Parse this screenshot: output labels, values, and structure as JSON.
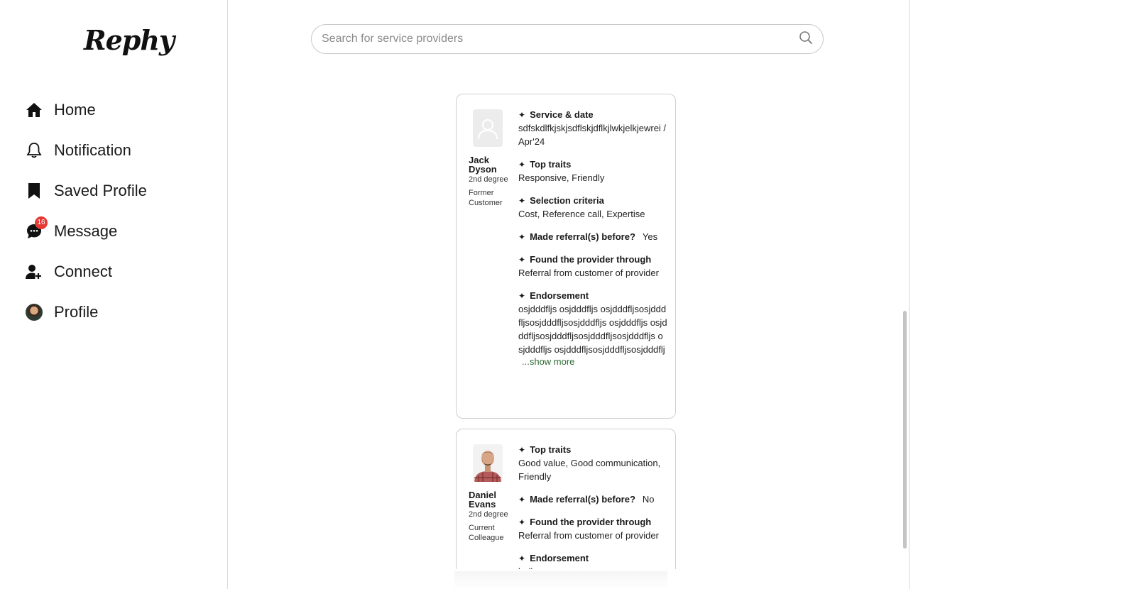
{
  "app": {
    "logo": "Rephy"
  },
  "sidebar": {
    "items": [
      {
        "label": "Home",
        "icon": "home-icon"
      },
      {
        "label": "Notification",
        "icon": "bell-icon"
      },
      {
        "label": "Saved Profile",
        "icon": "bookmark-icon"
      },
      {
        "label": "Message",
        "icon": "message-icon",
        "badge": "16"
      },
      {
        "label": "Connect",
        "icon": "add-user-icon"
      },
      {
        "label": "Profile",
        "icon": "avatar"
      }
    ]
  },
  "search": {
    "placeholder": "Search for service providers"
  },
  "cards": [
    {
      "name": "Jack Dyson",
      "degree": "2nd degree",
      "relation": "Former Customer",
      "service_title": "Service & date",
      "service_value": "sdfskdlfkjskjsdflskjdflkjlwkjelkjewrei / Apr'24",
      "traits_title": "Top traits",
      "traits_value": "Responsive, Friendly",
      "criteria_title": "Selection criteria",
      "criteria_value": "Cost, Reference call, Expertise",
      "referral_title": "Made referral(s) before?",
      "referral_value": "Yes",
      "found_title": "Found the provider through",
      "found_value": "Referral from customer of provider",
      "endorsement_title": "Endorsement",
      "endorsement_value": "osjdddfljs osjdddfljs osjdddfljsosjdddfljsosjdddfljsosjdddfljs osjdddfljs osjdddfljsosjdddfljsosjdddfljsosjdddfljs osjdddfljs osjdddfljsosjdddfljsosjdddflj",
      "show_more": "...show more"
    },
    {
      "name": "Daniel Evans",
      "degree": "2nd degree",
      "relation": "Current Colleague",
      "traits_title": "Top traits",
      "traits_value": "Good value, Good communication, Friendly",
      "referral_title": "Made referral(s) before?",
      "referral_value": "No",
      "found_title": "Found the provider through",
      "found_value": "Referral from customer of provider",
      "endorsement_title": "Endorsement",
      "endorsement_value": "hello"
    }
  ]
}
